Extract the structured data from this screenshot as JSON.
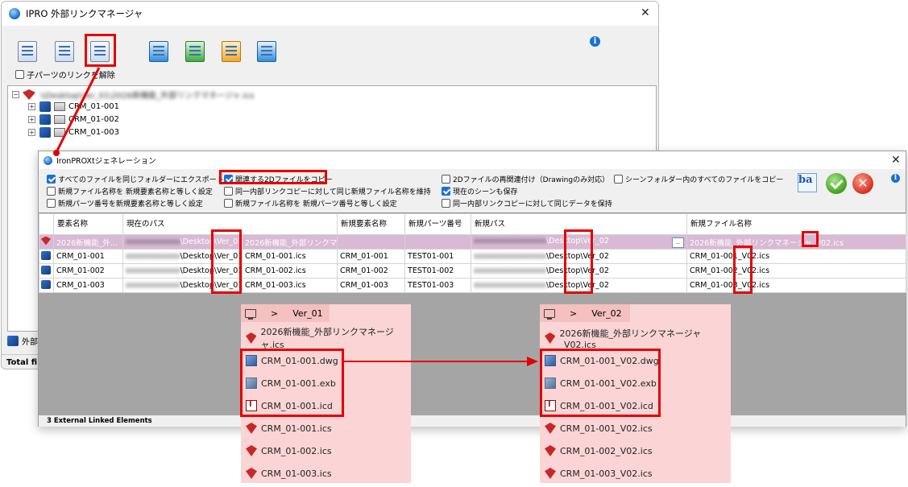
{
  "window1": {
    "title": "IPRO 外部リンクマネージャ",
    "close": "✕",
    "info": "i",
    "checkbox_label": "子パーツのリンクを解除",
    "tree_root_label": "\\\\Desktop\\Ver_01\\2026新機能_外部リンクマネージャ.ics",
    "tree_items": [
      "CRM_01-001",
      "CRM_01-002",
      "CRM_01-003"
    ],
    "bottom_tab_label": "外部",
    "status_text": "Total fi"
  },
  "window2": {
    "title": "IronPROXtジェネレーション",
    "close": "✕",
    "info": "i",
    "ba_label": "ba",
    "options": {
      "export_same_folder": "すべてのファイルを同じフォルダーにエクスポート",
      "copy_related_2d": "関連する2Dファイルをコピー",
      "reassociate_2d": "2Dファイルの再関連付け（Drawingのみ対応）",
      "copy_scene_folder": "シーンフォルダー内のすべてのファイルをコピー",
      "new_filename_equal_element": "新規ファイル名称を 新規要素名称と等しく設定",
      "same_internal_link_keep_name": "同一内部リンクコピーに対して同じ新規ファイル名称を維持",
      "save_current_scene": "現在のシーンも保存",
      "new_part_number_equal_element": "新規パーツ番号を新規要素名称と等しく設定",
      "new_filename_equal_part_number": "新規ファイル名称を 新規パーツ番号と等しく設定",
      "same_internal_link_keep_data": "同一内部リンクコピーに対して同じデータを保持"
    },
    "columns": [
      "要素名称",
      "現在のパス",
      "新規要素名称",
      "新規パーツ番号",
      "新規パス",
      "新規ファイル名称"
    ],
    "rows": [
      {
        "element": "2026新機能_外...",
        "cur_path": "\\Desktop\\Ver_01",
        "cur_file": "2026新機能_外部リンクマ...",
        "new_element": "",
        "new_part": "",
        "new_path": "\\Desktop\\Ver_02",
        "new_file": "2026新機能_外部リンクマネージャ_V02.ics",
        "selected": true
      },
      {
        "element": "CRM_01-001",
        "cur_path": "\\Desktop\\Ver_01",
        "cur_file": "CRM_01-001.ics",
        "new_element": "CRM_01-001",
        "new_part": "TEST01-001",
        "new_path": "\\Desktop\\Ver_02",
        "new_file": "CRM_01-001_V02.ics",
        "selected": false
      },
      {
        "element": "CRM_01-002",
        "cur_path": "\\Desktop\\Ver_01",
        "cur_file": "CRM_01-002.ics",
        "new_element": "CRM_01-002",
        "new_part": "TEST01-002",
        "new_path": "\\Desktop\\Ver_02",
        "new_file": "CRM_01-002_V02.ics",
        "selected": false
      },
      {
        "element": "CRM_01-003",
        "cur_path": "\\Desktop\\Ver_01",
        "cur_file": "CRM_01-003.ics",
        "new_element": "CRM_01-003",
        "new_part": "TEST01-003",
        "new_path": "\\Desktop\\Ver_02",
        "new_file": "CRM_01-003_V02.ics",
        "selected": false
      }
    ],
    "browse_label": "..",
    "status_text": "3 External Linked Elements"
  },
  "folder_old": {
    "breadcrumb_sep": ">",
    "name": "Ver_01",
    "files": [
      {
        "name": "2026新機能_外部リンクマネージャ.ics",
        "type": "ics"
      },
      {
        "name": "CRM_01-001.dwg",
        "type": "dwg"
      },
      {
        "name": "CRM_01-001.exb",
        "type": "exb"
      },
      {
        "name": "CRM_01-001.icd",
        "type": "icd"
      },
      {
        "name": "CRM_01-001.ics",
        "type": "ics"
      },
      {
        "name": "CRM_01-002.ics",
        "type": "ics"
      },
      {
        "name": "CRM_01-003.ics",
        "type": "ics"
      }
    ]
  },
  "folder_new": {
    "breadcrumb_sep": ">",
    "name": "Ver_02",
    "files": [
      {
        "name": "2026新機能_外部リンクマネージャ_V02.ics",
        "type": "ics"
      },
      {
        "name": "CRM_01-001_V02.dwg",
        "type": "dwg"
      },
      {
        "name": "CRM_01-001_V02.exb",
        "type": "exb"
      },
      {
        "name": "CRM_01-001_V02.icd",
        "type": "icd"
      },
      {
        "name": "CRM_01-001_V02.ics",
        "type": "ics"
      },
      {
        "name": "CRM_01-002_V02.ics",
        "type": "ics"
      },
      {
        "name": "CRM_01-003_V02.ics",
        "type": "ics"
      }
    ]
  },
  "colors": {
    "highlight": "#e50000",
    "folder_bg": "#fbd5d5",
    "selected_row": "#d9b9d4",
    "accent": "#1a6fd6"
  }
}
